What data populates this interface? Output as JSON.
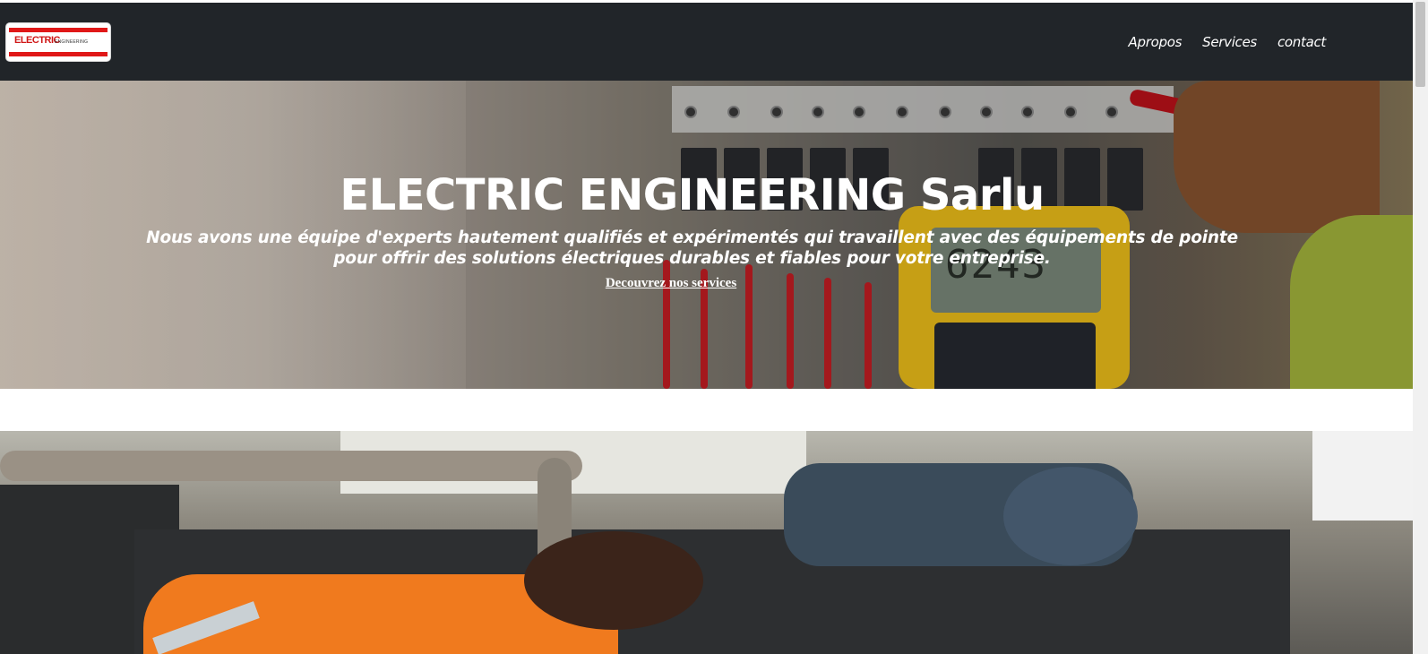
{
  "brand": {
    "logo_text": "ELECTRIC",
    "logo_subtext": "ENGINEERING",
    "logo_alt": "electric-engineering-logo"
  },
  "nav": {
    "items": [
      {
        "label": "Apropos"
      },
      {
        "label": "Services"
      },
      {
        "label": "contact"
      }
    ]
  },
  "hero": {
    "title": "ELECTRIC ENGINEERING Sarlu",
    "text": "Nous avons une équipe d'experts hautement qualifiés et expérimentés qui travaillent avec des équipements de pointe pour offrir des solutions électriques durables et fiables pour votre entreprise.",
    "link_label": "Decouvrez nos services",
    "meter_reading": "6243"
  },
  "colors": {
    "navbar": "#212529",
    "nav_text": "#ffffff",
    "hero_text": "#ffffff",
    "logo_accent": "#e01818"
  }
}
